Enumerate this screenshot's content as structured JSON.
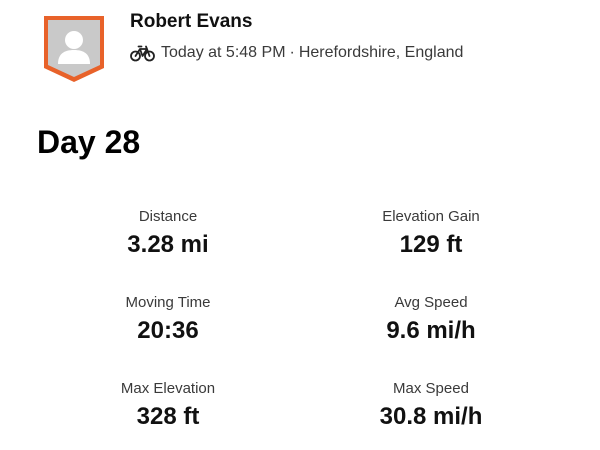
{
  "athlete": {
    "name": "Robert Evans"
  },
  "activity": {
    "sport_icon": "bike-icon",
    "timestamp": "Today at 5:48 PM",
    "separator": "·",
    "location": "Herefordshire, England",
    "title": "Day 28"
  },
  "stats": [
    {
      "label": "Distance",
      "value": "3.28 mi"
    },
    {
      "label": "Elevation Gain",
      "value": "129 ft"
    },
    {
      "label": "Moving Time",
      "value": "20:36"
    },
    {
      "label": "Avg Speed",
      "value": "9.6 mi/h"
    },
    {
      "label": "Max Elevation",
      "value": "328 ft"
    },
    {
      "label": "Max Speed",
      "value": "30.8 mi/h"
    }
  ],
  "colors": {
    "badge_orange": "#e8622a",
    "badge_fill": "#c9c9c9",
    "text_primary": "#111111",
    "text_secondary": "#3a3a3a"
  }
}
